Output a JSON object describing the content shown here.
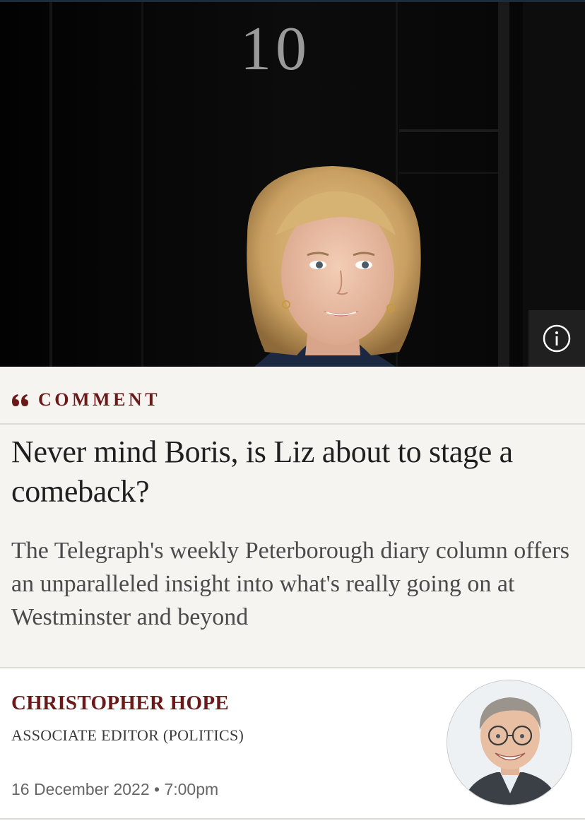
{
  "hero": {
    "door_number": "10",
    "info_icon": "info-icon"
  },
  "article": {
    "kicker": "COMMENT",
    "kicker_icon": "quote-icon",
    "headline": "Never mind Boris, is Liz about to stage a comeback?",
    "standfirst": "The Telegraph's weekly Peterborough diary column offers an unparalleled insight into what's really going on at Westminster and beyond"
  },
  "byline": {
    "author": "CHRISTOPHER HOPE",
    "role": "ASSOCIATE EDITOR (POLITICS)",
    "date": "16 December 2022 • 7:00pm"
  },
  "colors": {
    "accent": "#6b1a1a",
    "background": "#f5f4f0",
    "byline_background": "#ffffff"
  }
}
